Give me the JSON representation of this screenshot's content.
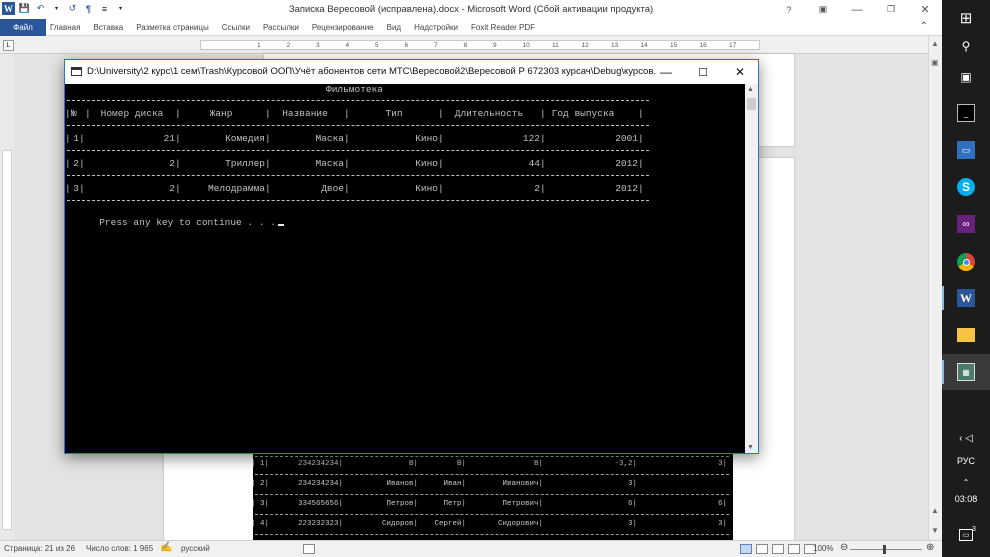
{
  "word": {
    "title": "Записка Вересовой (исправлена).docx - Microsoft Word (Сбой активации продукта)",
    "file_tab": "Файл",
    "tabs": [
      "Главная",
      "Вставка",
      "Разметка страницы",
      "Ссылки",
      "Рассылки",
      "Рецензирование",
      "Вид",
      "Надстройки",
      "Foxit Reader PDF"
    ],
    "ruler_numbers": [
      "1",
      "2",
      "3",
      "4",
      "5",
      "6",
      "7",
      "8",
      "9",
      "10",
      "11",
      "12",
      "13",
      "14",
      "15",
      "16",
      "17"
    ],
    "ruler_corner": "L"
  },
  "status": {
    "page": "Страница: 21 из 26",
    "words": "Число слов: 1 965",
    "language": "русский",
    "zoom": "100%"
  },
  "doc_table": {
    "rows": [
      [
        "| 1|",
        "234234234|",
        "В|",
        "В|",
        "В|",
        "-3,2|",
        "3|"
      ],
      [
        "| 2|",
        "234234234|",
        "Иванов|",
        "Иван|",
        "Иванович|",
        "3|",
        ""
      ],
      [
        "| 3|",
        "334565656|",
        "Петров|",
        "Петр|",
        "Петрович|",
        "6|",
        "6|"
      ],
      [
        "| 4|",
        "223232323|",
        "Сидоров|",
        "Сергей|",
        "Сидорович|",
        "3|",
        "3|"
      ]
    ]
  },
  "console": {
    "title": "D:\\University\\2 курс\\1 сем\\Trash\\Курсовой ООП\\Учёт абонентов сети МТС\\Вересовой2\\Вересовой Р 672303 курсач\\Debug\\курсов...",
    "heading": "Фильмотека",
    "headers": [
      "№",
      "Номер диска",
      "Жанр",
      "Название",
      "Тип",
      "Длительность",
      "Год выпуска"
    ],
    "rows": [
      [
        "1",
        "21",
        "Комедия",
        "Маска",
        "Кино",
        "122",
        "2001"
      ],
      [
        "2",
        "2",
        "Триллер",
        "Маска",
        "Кино",
        "44",
        "2012"
      ],
      [
        "3",
        "2",
        "Мелодрамма",
        "Двое",
        "Кино",
        "2",
        "2012"
      ]
    ],
    "prompt": "Press any key to continue . . ."
  },
  "taskbar": {
    "language": "РУС",
    "time": "03:08",
    "notification_count": "3"
  }
}
